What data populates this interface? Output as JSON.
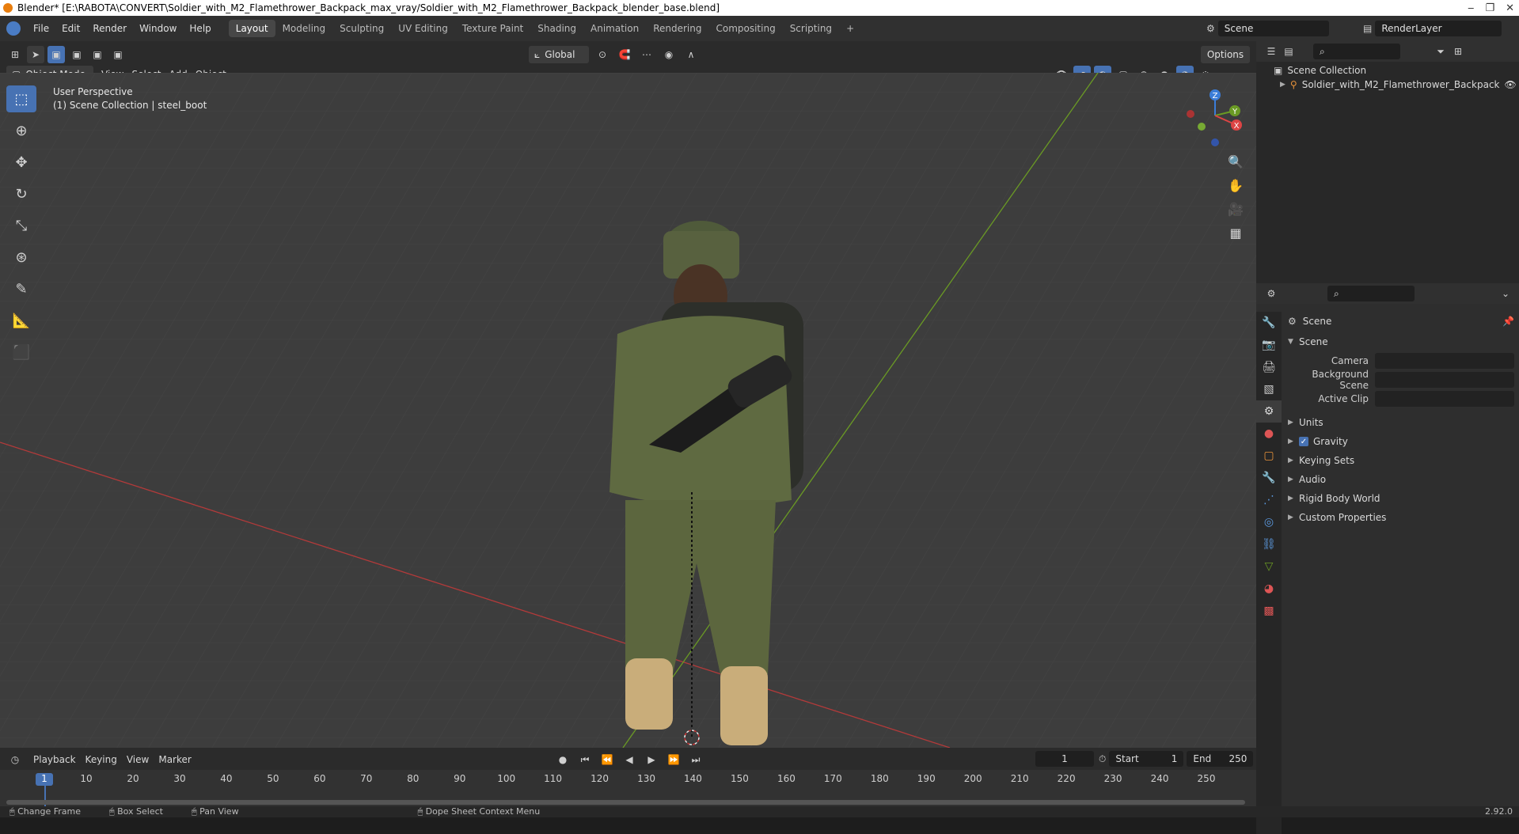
{
  "window": {
    "title": "Blender* [E:\\RABOTA\\CONVERT\\Soldier_with_M2_Flamethrower_Backpack_max_vray/Soldier_with_M2_Flamethrower_Backpack_blender_base.blend]",
    "controls": [
      "‒",
      "❐",
      "✕"
    ]
  },
  "menu": [
    "File",
    "Edit",
    "Render",
    "Window",
    "Help"
  ],
  "workspaces": [
    "Layout",
    "Modeling",
    "Sculpting",
    "UV Editing",
    "Texture Paint",
    "Shading",
    "Animation",
    "Rendering",
    "Compositing",
    "Scripting"
  ],
  "add_workspace": "+",
  "scene_selector": "Scene",
  "render_layer": "RenderLayer",
  "viewport": {
    "transform_orientation": "Global",
    "options_label": "Options",
    "mode": "Object Mode",
    "header_menu": [
      "View",
      "Select",
      "Add",
      "Object"
    ],
    "overlay_title": "User Perspective",
    "overlay_subtitle": "(1) Scene Collection | steel_boot",
    "gizmo_labels": {
      "z": "Z",
      "y": "Y",
      "x": "X"
    }
  },
  "outliner": {
    "root": "Scene Collection",
    "items": [
      {
        "label": "Soldier_with_M2_Flamethrower_Backpack"
      }
    ]
  },
  "properties": {
    "context": "Scene",
    "panel_title": "Scene",
    "fields": [
      {
        "label": "Camera",
        "value": ""
      },
      {
        "label": "Background Scene",
        "value": ""
      },
      {
        "label": "Active Clip",
        "value": ""
      }
    ],
    "sections": [
      {
        "label": "Units",
        "checkbox": false
      },
      {
        "label": "Gravity",
        "checkbox": true
      },
      {
        "label": "Keying Sets",
        "checkbox": false
      },
      {
        "label": "Audio",
        "checkbox": false
      },
      {
        "label": "Rigid Body World",
        "checkbox": false
      },
      {
        "label": "Custom Properties",
        "checkbox": false
      }
    ]
  },
  "timeline": {
    "menu": [
      "Playback",
      "Keying",
      "View",
      "Marker"
    ],
    "current_frame": "1",
    "start_label": "Start",
    "start": "1",
    "end_label": "End",
    "end": "250",
    "ticks": [
      "1",
      "10",
      "20",
      "30",
      "40",
      "50",
      "60",
      "70",
      "80",
      "90",
      "100",
      "110",
      "120",
      "130",
      "140",
      "150",
      "160",
      "170",
      "180",
      "190",
      "200",
      "210",
      "220",
      "230",
      "240",
      "250"
    ]
  },
  "statusbar": {
    "items": [
      "Change Frame",
      "Box Select",
      "Pan View",
      "Dope Sheet Context Menu"
    ],
    "version": "2.92.0"
  },
  "colors": {
    "accent": "#4772b3",
    "x_axis": "#b33a3a",
    "y_axis": "#6a9a24",
    "grid": "#454545",
    "viewport_bg": "#3d3d3d"
  }
}
